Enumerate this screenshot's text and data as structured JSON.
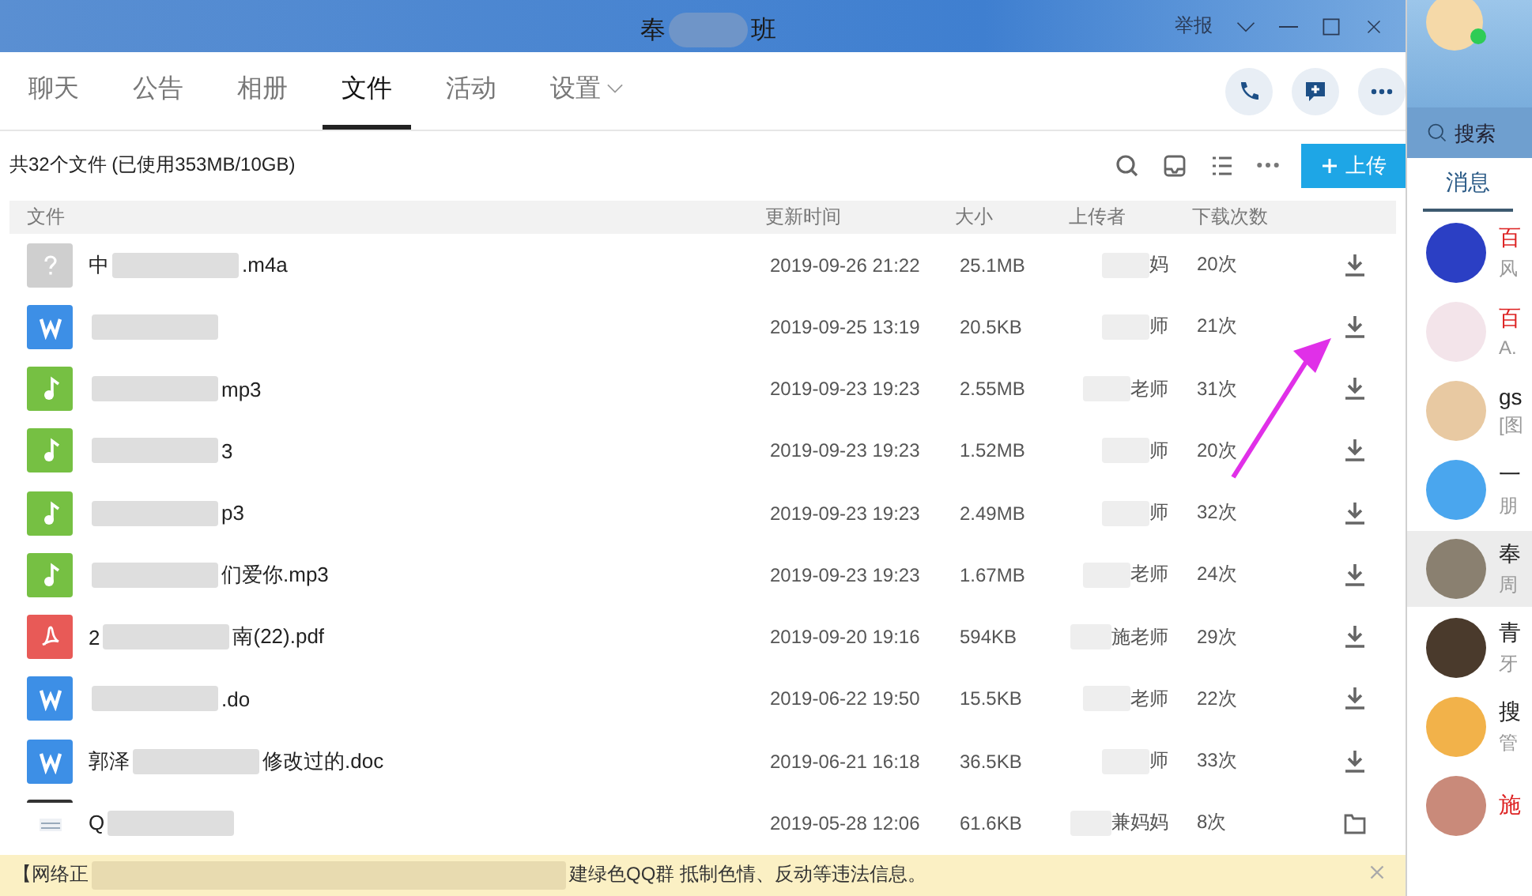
{
  "window": {
    "title_start": "奉",
    "title_end": "班",
    "report": "举报"
  },
  "tabs": [
    {
      "label": "聊天",
      "selected": false
    },
    {
      "label": "公告",
      "selected": false
    },
    {
      "label": "相册",
      "selected": false
    },
    {
      "label": "文件",
      "selected": true
    },
    {
      "label": "活动",
      "selected": false
    },
    {
      "label": "设置",
      "selected": false,
      "dropdown": true
    }
  ],
  "toolbar": {
    "summary": "共32个文件 (已使用353MB/10GB)",
    "upload": "上传"
  },
  "table": {
    "columns": [
      "文件",
      "更新时间",
      "大小",
      "上传者",
      "下载次数"
    ],
    "rows": [
      {
        "kind": "unknown",
        "name_start": "中",
        "name_end": ".m4a",
        "time": "2019-09-26 21:22",
        "size": "25.1MB",
        "uploader": "妈",
        "downloads": "20次",
        "action": {
          "kind": "download"
        }
      },
      {
        "kind": "word",
        "time": "2019-09-25 13:19",
        "size": "20.5KB",
        "uploader": "师",
        "downloads": "21次",
        "action": {
          "kind": "download"
        }
      },
      {
        "kind": "music",
        "name_end": "mp3",
        "time": "2019-09-23 19:23",
        "size": "2.55MB",
        "uploader": "老师",
        "downloads": "31次",
        "action": {
          "kind": "download"
        }
      },
      {
        "kind": "music",
        "name_end": "3",
        "time": "2019-09-23 19:23",
        "size": "1.52MB",
        "uploader": "师",
        "downloads": "20次",
        "action": {
          "kind": "download"
        }
      },
      {
        "kind": "music",
        "name_end": "p3",
        "time": "2019-09-23 19:23",
        "size": "2.49MB",
        "uploader": "师",
        "downloads": "32次",
        "action": {
          "kind": "download"
        }
      },
      {
        "kind": "music",
        "name_end": "们爱你.mp3",
        "time": "2019-09-23 19:23",
        "size": "1.67MB",
        "uploader": "老师",
        "downloads": "24次",
        "action": {
          "kind": "download"
        }
      },
      {
        "kind": "pdf",
        "name_start": "2",
        "name_end": "南(22).pdf",
        "time": "2019-09-20 19:16",
        "size": "594KB",
        "uploader": "施老师",
        "downloads": "29次",
        "action": {
          "kind": "download"
        }
      },
      {
        "kind": "word",
        "name_end": ".do",
        "time": "2019-06-22 19:50",
        "size": "15.5KB",
        "uploader": "老师",
        "downloads": "22次",
        "action": {
          "kind": "download"
        }
      },
      {
        "kind": "word",
        "name_start": "郭泽",
        "name_end": "修改过的.doc",
        "time": "2019-06-21 16:18",
        "size": "36.5KB",
        "uploader": "师",
        "downloads": "33次",
        "action": {
          "kind": "download"
        }
      },
      {
        "kind": "image",
        "name_start": "Q",
        "time": "2019-05-28 12:06",
        "size": "61.6KB",
        "uploader": "兼妈妈",
        "downloads": "8次",
        "action": {
          "kind": "folder"
        }
      }
    ]
  },
  "notice": {
    "text_start": "【网络正",
    "text_end": "建绿色QQ群 抵制色情、反动等违法信息。"
  },
  "sidebar": {
    "search": {
      "placeholder": "搜索"
    },
    "tab": "消息",
    "items": [
      {
        "title": "百",
        "preview": "风",
        "official": true,
        "selected": false,
        "color": "#2b3fc4"
      },
      {
        "title": "百",
        "preview": "A.",
        "official": true,
        "selected": false,
        "color": "#f3e4ea"
      },
      {
        "title": "gs",
        "preview": "[图",
        "official": false,
        "selected": false,
        "color": "#e8c9a2"
      },
      {
        "title": "一",
        "preview": "朋",
        "official": false,
        "selected": false,
        "color": "#4aa6ee"
      },
      {
        "title": "奉",
        "preview": "周",
        "official": false,
        "selected": true,
        "color": "#8a8070"
      },
      {
        "title": "青",
        "preview": "牙",
        "official": false,
        "selected": false,
        "color": "#4a3a2c"
      },
      {
        "title": "搜",
        "preview": "管",
        "official": false,
        "selected": false,
        "color": "#f2b24a"
      },
      {
        "title": "施",
        "official": true,
        "selected": false,
        "color": "#c98a7a"
      }
    ]
  }
}
